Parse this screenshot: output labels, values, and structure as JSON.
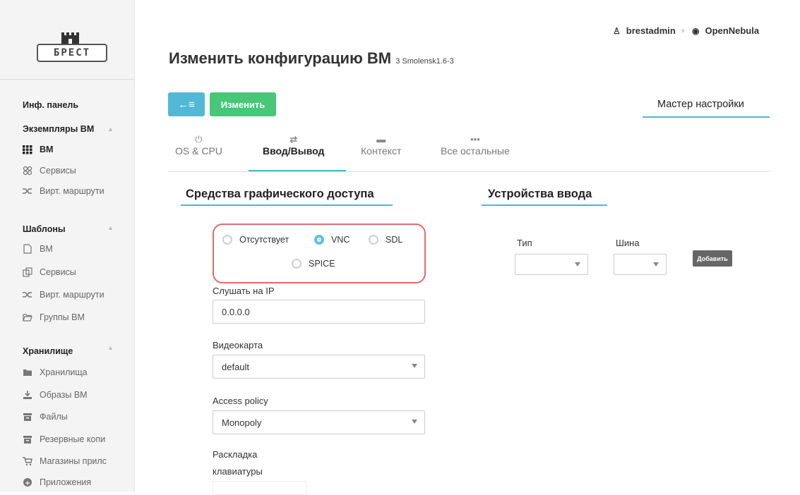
{
  "logo": {
    "text": "БРЕСТ"
  },
  "header": {
    "user": "brestadmin",
    "zone": "OpenNebula",
    "title": "Изменить конфигурацию ВМ",
    "subtitle": "3 Smolensk1.6-3"
  },
  "toolbar": {
    "back_label": "←≡",
    "save_label": "Изменить",
    "wizard_label": "Мастер настройки"
  },
  "sidebar": {
    "sections": [
      {
        "label": "Инф. панель"
      },
      {
        "label": "Экземпляры ВМ"
      },
      {
        "label": "Шаблоны"
      },
      {
        "label": "Хранилище"
      }
    ],
    "items": [
      {
        "label": "ВМ",
        "icon": "grid-icon"
      },
      {
        "label": "Сервисы",
        "icon": "services-icon"
      },
      {
        "label": "Вирт. маршрути",
        "icon": "shuffle-icon"
      },
      {
        "label": "ВМ",
        "icon": "file-icon"
      },
      {
        "label": "Сервисы",
        "icon": "copy-icon"
      },
      {
        "label": "Вирт. маршрути",
        "icon": "shuffle-icon"
      },
      {
        "label": "Группы ВМ",
        "icon": "folder-open-icon"
      },
      {
        "label": "Хранилища",
        "icon": "folder-icon"
      },
      {
        "label": "Образы ВМ",
        "icon": "download-icon"
      },
      {
        "label": "Файлы",
        "icon": "archive-icon"
      },
      {
        "label": "Резервные копи",
        "icon": "archive-icon"
      },
      {
        "label": "Магазины прилс",
        "icon": "cart-icon"
      },
      {
        "label": "Приложения",
        "icon": "cloud-icon"
      }
    ]
  },
  "tabs": [
    {
      "label": "OS & CPU",
      "icon": "power-icon"
    },
    {
      "label": "Ввод/Вывод",
      "icon": "arrows-icon"
    },
    {
      "label": "Контекст",
      "icon": "folder-icon"
    },
    {
      "label": "Все остальные",
      "icon": "ellipsis-icon"
    }
  ],
  "graphics": {
    "title": "Средства графического доступа",
    "options": [
      "Отсутствует",
      "VNC",
      "SDL",
      "SPICE"
    ],
    "selected": "VNC",
    "listen_label": "Слушать на IP",
    "listen_value": "0.0.0.0",
    "video_label": "Видеокарта",
    "video_value": "default",
    "policy_label": "Access policy",
    "policy_value": "Monopoly",
    "keymap_label_1": "Раскладка",
    "keymap_label_2": "клавиатуры"
  },
  "inputs": {
    "title": "Устройства ввода",
    "type_label": "Тип",
    "bus_label": "Шина",
    "add_label": "Добавить"
  },
  "colors": {
    "accent": "#4db7d0",
    "save": "#48c778",
    "back": "#52b8d6",
    "highlight": "#e46a6a"
  }
}
